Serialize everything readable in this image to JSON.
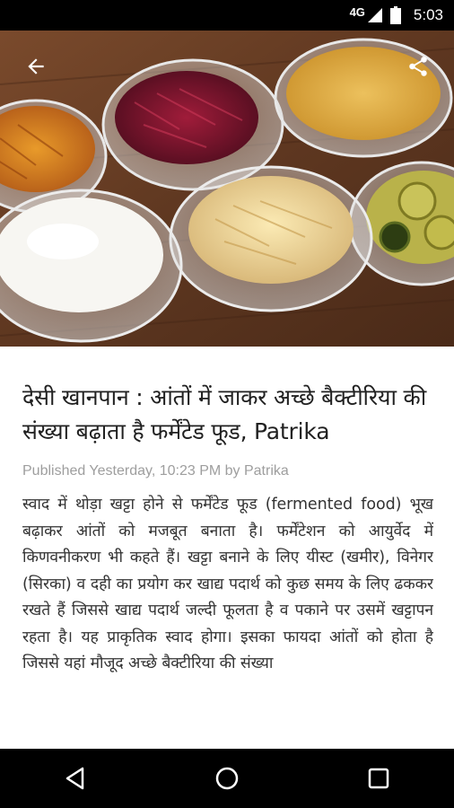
{
  "status_bar": {
    "network": "4G",
    "time": "5:03"
  },
  "toolbar": {
    "back_icon": "arrow-back-icon",
    "share_icon": "share-icon"
  },
  "hero": {
    "description_icon": "fermented-food-photo"
  },
  "article": {
    "headline": "देसी खानपान : आंतों में जाकर अच्छे बैक्टीरिया की संख्या बढ़ाता है फर्मेंटेड फूड, Patrika",
    "meta": "Published Yesterday, 10:23 PM by Patrika",
    "body": "स्वाद में थोड़ा खट्टा होने से फर्मेंटेड फूड (fermented food) भूख बढ़ाकर आंतों को मजबूत बनाता है। फर्मेंटेशन को आयुर्वेद में किणवनीकरण भी कहते हैं। खट्टा बनाने के लिए यीस्ट (खमीर), विनेगर (सिरका) व दही का प्रयोग कर खाद्य पदार्थ को कुछ समय के लिए ढककर रखते हैं जिससे खाद्य पदार्थ जल्दी फूलता है व पकाने पर उसमें खट्टापन रहता है। यह प्राकृतिक स्वाद होगा। इसका फायदा आंतों को होता है जिससे यहां मौजूद अच्छे बैक्टीरिया की संख्या"
  },
  "nav_bar": {
    "back_icon": "nav-back-icon",
    "home_icon": "nav-home-icon",
    "recents_icon": "nav-recents-icon"
  }
}
